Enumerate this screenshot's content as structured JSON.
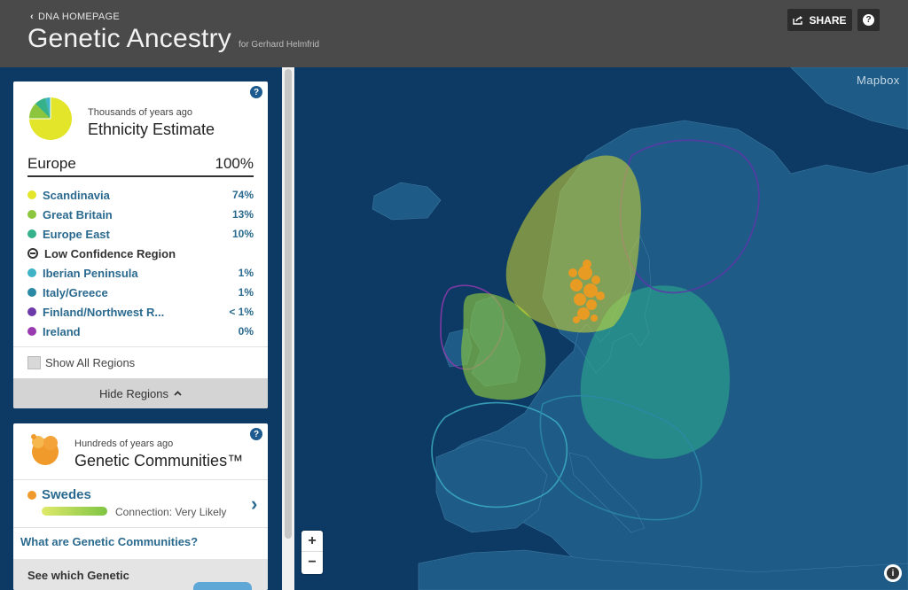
{
  "header": {
    "back_label": "DNA HOMEPAGE",
    "title": "Genetic Ancestry",
    "subtitle": "for Gerhard Helmfrid",
    "share_label": "SHARE",
    "help_glyph": "?"
  },
  "ethnicity": {
    "kicker": "Thousands of years ago",
    "title": "Ethnicity Estimate",
    "region_group": "Europe",
    "region_total": "100%",
    "regions": [
      {
        "name": "Scandinavia",
        "pct": "74%",
        "color": "#e3e52a"
      },
      {
        "name": "Great Britain",
        "pct": "13%",
        "color": "#8cc63f"
      },
      {
        "name": "Europe East",
        "pct": "10%",
        "color": "#35b28a"
      },
      {
        "name": "Low Confidence Region",
        "pct": "",
        "color": "#333333"
      },
      {
        "name": "Iberian Peninsula",
        "pct": "1%",
        "color": "#3fb3c7"
      },
      {
        "name": "Italy/Greece",
        "pct": "1%",
        "color": "#2a8aa6"
      },
      {
        "name": "Finland/Northwest R...",
        "pct": "< 1%",
        "color": "#6d3aaa"
      },
      {
        "name": "Ireland",
        "pct": "0%",
        "color": "#9a3ab0"
      }
    ],
    "show_all_label": "Show All Regions",
    "hide_label": "Hide Regions",
    "hide_icon": "chevron-up-icon"
  },
  "communities": {
    "kicker": "Hundreds of years ago",
    "title": "Genetic Communities™",
    "community_name": "Swedes",
    "connection": "Connection: Very Likely",
    "info_link": "What are Genetic Communities?",
    "see_which": "See which Genetic"
  },
  "map": {
    "attribution": "Mapbox",
    "zoom_in": "+",
    "zoom_out": "−",
    "info_glyph": "i"
  }
}
